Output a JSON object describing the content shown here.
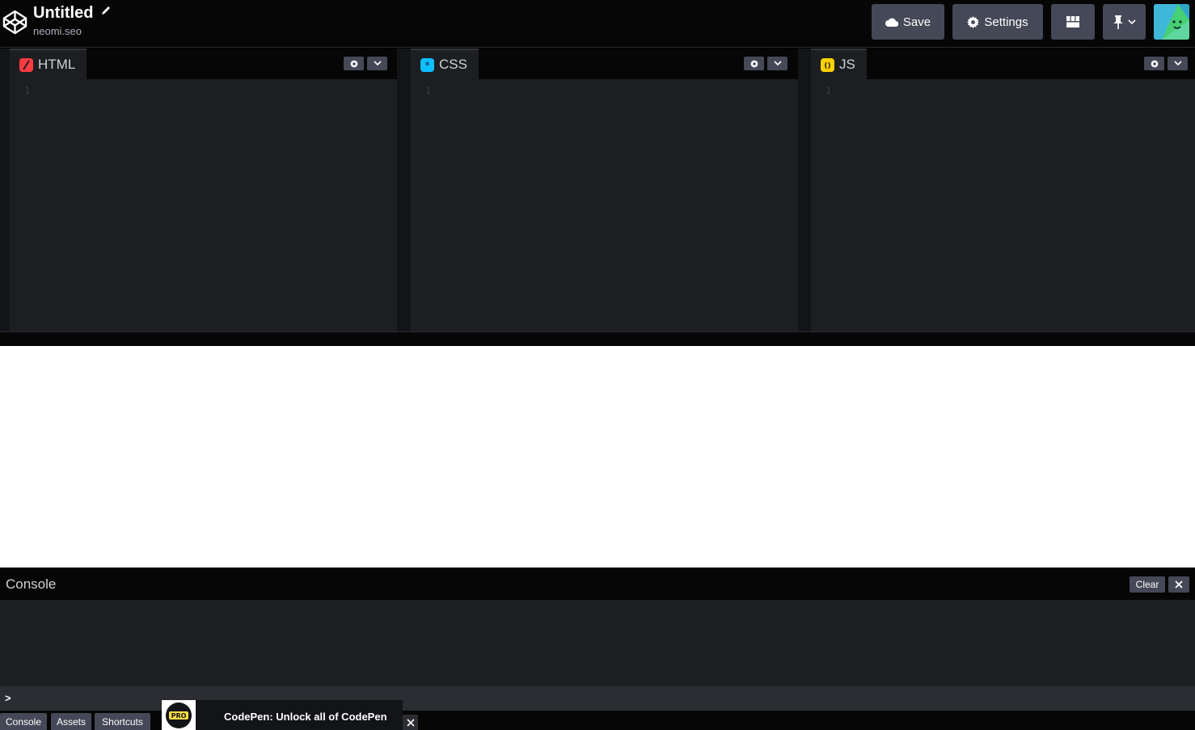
{
  "header": {
    "pen_title": "Untitled",
    "owner": "neomi.seo",
    "buttons": {
      "save_label": "Save",
      "settings_label": "Settings"
    }
  },
  "editors": [
    {
      "label": "HTML",
      "icon": "html-icon",
      "accent": "#ff3c41",
      "line_number": "1"
    },
    {
      "label": "CSS",
      "icon": "css-icon",
      "accent": "#0ebeff",
      "line_number": "1"
    },
    {
      "label": "JS",
      "icon": "js-icon",
      "accent": "#fcd000",
      "line_number": "1"
    }
  ],
  "console": {
    "title": "Console",
    "clear_label": "Clear",
    "prompt": ">"
  },
  "footer": {
    "console_label": "Console",
    "assets_label": "Assets",
    "shortcuts_label": "Shortcuts"
  },
  "promo": {
    "badge": "PRO",
    "text": "CodePen: Unlock all of CodePen"
  },
  "colors": {
    "header_bg": "#060606",
    "editor_bg": "#1d1e22",
    "button_bg": "#444857",
    "preview_bg": "#ffffff"
  }
}
